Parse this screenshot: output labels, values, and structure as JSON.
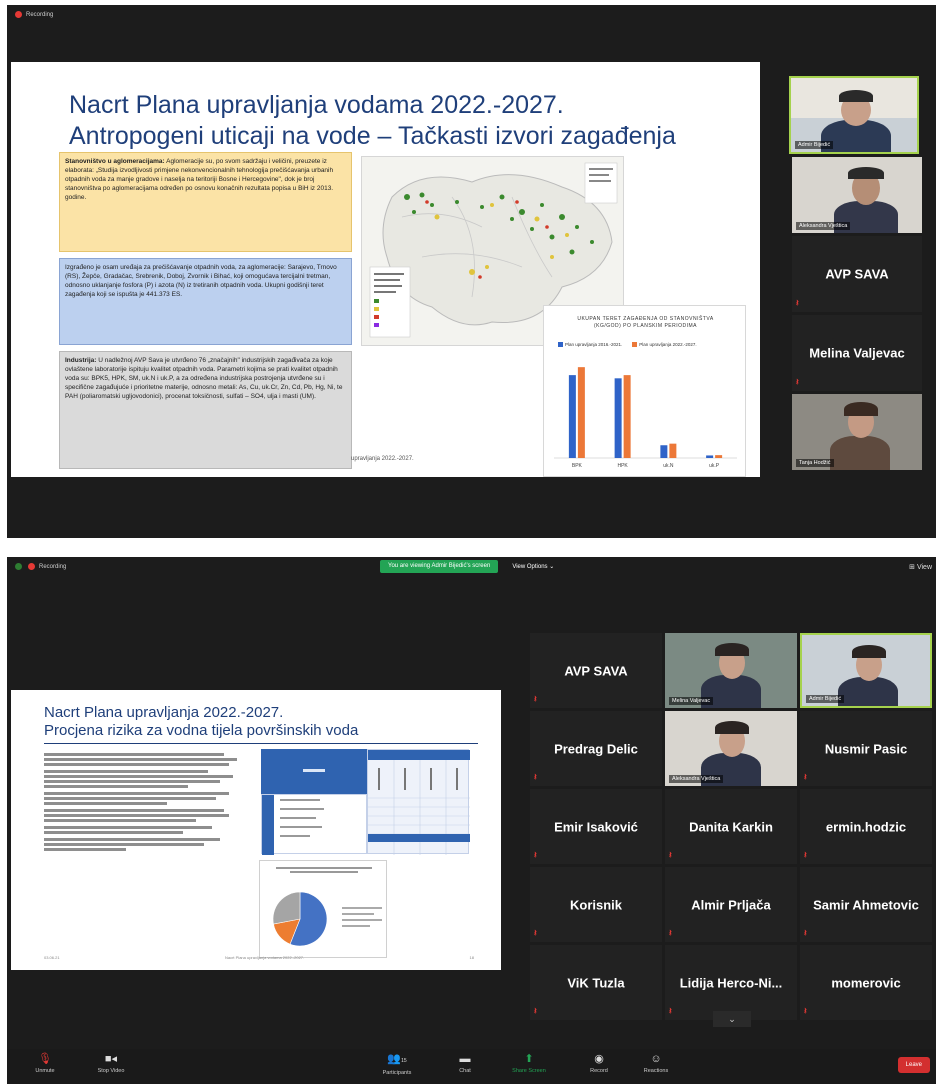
{
  "shot1": {
    "recording_label": "Recording",
    "slide": {
      "title_line1": "Nacrt Plana upravljanja vodama 2022.-2027.",
      "title_line2": "Antropogeni uticaji na vode – Tačkasti izvori zagađenja",
      "box_yellow_head": "Stanovništvo u aglomeracijama:",
      "box_yellow_text": " Aglomeracije su, po svom sadržaju i veličini, preuzete iz elaborata: „Studija izvodljivosti primjene nekonvencionalnih tehnologija prečišćavanja urbanih otpadnih voda za manje gradove i naselja na teritoriji Bosne i Hercegovine\", dok je broj stanovništva po aglomeracijama određen po osnovu konačnih rezultata popisa u BiH iz 2013. godine.",
      "box_blue_text": "Izgrađeno je osam uređaja za prečišćavanje otpadnih voda, za aglomeracije: Sarajevo, Trnovo (RS), Žepče, Gradačac, Srebrenik, Doboj, Zvornik i Bihać, koji omogućava tercijalni tretman, odnosno uklanjanje fosfora (P) i azota (N) iz tretiranih otpadnih voda. Ukupni godišnji teret zagađenja koji se ispušta je 441.373 ES.",
      "box_gray_head": "Industrija:",
      "box_gray_text": " U nadležnoj AVP Sava je utvrđeno 76 „značajnih\" industrijskih zagađivača za koje ovlaštene laboratorije ispituju kvalitet otpadnih voda. Parametri kojima se prati kvalitet otpadnih voda su: BPK5, HPK, SM, uk.N i uk.P, a za određena industrijska postrojenja utvrđene su i specifične zagađujuće i prioritetne materije, odnosno metali: As, Cu, uk.Cr, Zn, Cd, Pb, Hg, Ni, te PAH (poliaromatski ugljovodonici), procenat toksičnosti, sulfati – SO4, ulja i masti (UM).",
      "footer_fragment": "upravljanja 2022.-2027."
    },
    "chart_data": {
      "type": "bar",
      "title": "UKUPAN TERET ZAGAĐENJA OD STANOVNIŠTVA (KG/GOD) PO PLANSKIM PERIODIMA",
      "categories": [
        "BPK",
        "HPK",
        "uk.N",
        "uk.P"
      ],
      "series": [
        {
          "name": "Plan upravljanja 2016.-2021.",
          "values": [
            26000000,
            25000000,
            4000000,
            800000
          ]
        },
        {
          "name": "Plan upravljanja 2022.-2027.",
          "values": [
            28500000,
            26000000,
            4500000,
            900000
          ]
        }
      ],
      "ylim": [
        0,
        32000000
      ],
      "colors": [
        "#2f63c8",
        "#ec7838"
      ]
    },
    "participants": [
      {
        "label": "Admir Bijedić",
        "kind": "video",
        "active": true
      },
      {
        "label": "Aleksandra Vještica",
        "kind": "video",
        "active": false
      },
      {
        "label": "AVP SAVA",
        "kind": "name",
        "muted": true
      },
      {
        "label": "Melina Valjevac",
        "kind": "name",
        "muted": true
      },
      {
        "label": "Tanja Hodžić",
        "kind": "video",
        "active": false
      }
    ]
  },
  "shot2": {
    "recording_label": "Recording",
    "viewing_banner": "You are viewing Admir Bijedić's screen",
    "view_options": "View Options",
    "view_right": "View",
    "slide": {
      "title_line1": "Nacrt Plana upravljanja 2022.-2027.",
      "title_line2": "Procjena rizika za vodna tijela površinskih voda",
      "footer_left": "03.06.21",
      "footer_center": "Nacrt Plana upravljanja vodama 2022.-2027.",
      "footer_right": "18"
    },
    "pie_chart": {
      "type": "pie",
      "values": [
        56,
        16,
        28
      ],
      "colors": [
        "#4472c4",
        "#ed7d31",
        "#a5a5a5"
      ]
    },
    "participants": [
      {
        "label": "AVP SAVA",
        "kind": "name",
        "muted": true
      },
      {
        "label": "Melina Valjevac",
        "kind": "video"
      },
      {
        "label": "Admir Bijedić",
        "kind": "video",
        "active": true
      },
      {
        "label": "Predrag Delic",
        "kind": "name",
        "muted": true
      },
      {
        "label": "Aleksandra Vještica",
        "kind": "video"
      },
      {
        "label": "Nusmir Pasic",
        "kind": "name",
        "muted": true
      },
      {
        "label": "Emir Isaković",
        "kind": "name",
        "muted": true
      },
      {
        "label": "Danita Karkin",
        "kind": "name",
        "muted": true
      },
      {
        "label": "ermin.hodzic",
        "kind": "name",
        "muted": true
      },
      {
        "label": "Korisnik",
        "kind": "name",
        "muted": true
      },
      {
        "label": "Almir Prljača",
        "kind": "name",
        "muted": true
      },
      {
        "label": "Samir Ahmetovic",
        "kind": "name",
        "muted": true
      },
      {
        "label": "ViK Tuzla",
        "kind": "name",
        "muted": true
      },
      {
        "label": "Lidija Herco-Ni...",
        "kind": "name",
        "muted": true
      },
      {
        "label": "momerovic",
        "kind": "name",
        "muted": true
      }
    ],
    "toolbar": {
      "unmute": "Unmute",
      "stop_video": "Stop Video",
      "participants": "Participants",
      "participants_count": "15",
      "chat": "Chat",
      "share_screen": "Share Screen",
      "record": "Record",
      "reactions": "Reactions",
      "leave": "Leave"
    },
    "colors": {
      "banner": "#23a455",
      "leave": "#d32f2f",
      "active_border": "#a5d24d"
    }
  }
}
